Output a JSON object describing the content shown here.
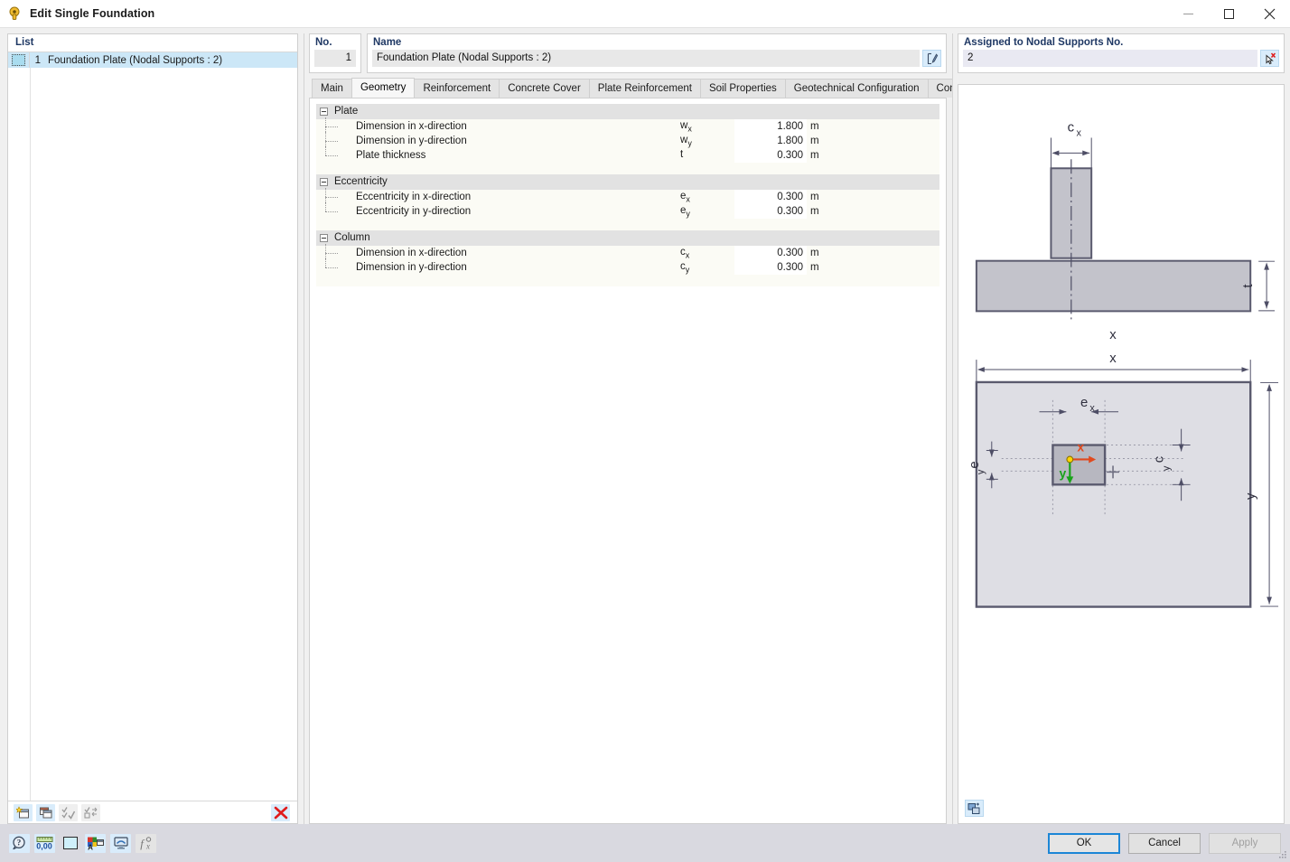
{
  "window": {
    "title": "Edit Single Foundation",
    "icon": "foundation-icon",
    "controls": {
      "minimize": "minimize-icon",
      "maximize": "maximize-icon",
      "close": "close-icon"
    }
  },
  "left_panel": {
    "header": "List",
    "rows": [
      {
        "num": "1",
        "label": "Foundation Plate (Nodal Supports : 2)",
        "selected": true
      }
    ],
    "toolbar": [
      {
        "name": "new-item-button",
        "enabled": true
      },
      {
        "name": "copy-item-button",
        "enabled": true
      },
      {
        "name": "select-all-button",
        "enabled": false
      },
      {
        "name": "invert-selection-button",
        "enabled": false
      },
      {
        "name": "delete-item-button",
        "enabled": true
      }
    ]
  },
  "fields": {
    "no_label": "No.",
    "no_value": "1",
    "name_label": "Name",
    "name_value": "Foundation Plate (Nodal Supports : 2)",
    "name_edit_icon": "edit-pencil-icon",
    "assigned_label": "Assigned to Nodal Supports No.",
    "assigned_value": "2",
    "assigned_pick_icon": "select-cursor-icon"
  },
  "tabs": [
    {
      "label": "Main",
      "active": false
    },
    {
      "label": "Geometry",
      "active": true
    },
    {
      "label": "Reinforcement",
      "active": false
    },
    {
      "label": "Concrete Cover",
      "active": false
    },
    {
      "label": "Plate Reinforcement",
      "active": false
    },
    {
      "label": "Soil Properties",
      "active": false
    },
    {
      "label": "Geotechnical Configuration",
      "active": false
    },
    {
      "label": "Concrete Configuration",
      "active": false
    }
  ],
  "property_groups": [
    {
      "title": "Plate",
      "expanded": true,
      "rows": [
        {
          "desc": "Dimension in x-direction",
          "sym": "w",
          "sub": "x",
          "value": "1.800",
          "unit": "m"
        },
        {
          "desc": "Dimension in y-direction",
          "sym": "w",
          "sub": "y",
          "value": "1.800",
          "unit": "m"
        },
        {
          "desc": "Plate thickness",
          "sym": "t",
          "sub": "",
          "value": "0.300",
          "unit": "m"
        }
      ]
    },
    {
      "title": "Eccentricity",
      "expanded": true,
      "rows": [
        {
          "desc": "Eccentricity in x-direction",
          "sym": "e",
          "sub": "x",
          "value": "0.300",
          "unit": "m"
        },
        {
          "desc": "Eccentricity in y-direction",
          "sym": "e",
          "sub": "y",
          "value": "0.300",
          "unit": "m"
        }
      ]
    },
    {
      "title": "Column",
      "expanded": true,
      "rows": [
        {
          "desc": "Dimension in x-direction",
          "sym": "c",
          "sub": "x",
          "value": "0.300",
          "unit": "m"
        },
        {
          "desc": "Dimension in y-direction",
          "sym": "c",
          "sub": "y",
          "value": "0.300",
          "unit": "m"
        }
      ]
    }
  ],
  "drawing": {
    "elevation_labels": {
      "column_width": "c",
      "column_width_sub": "x",
      "thickness": "t",
      "plate_width": "x"
    },
    "plan_labels": {
      "width": "x",
      "height": "y",
      "ecc_x": "e",
      "ecc_x_sub": "x",
      "ecc_y": "e",
      "ecc_y_sub": "y",
      "col_y": "c",
      "col_y_sub": "y",
      "axis_x": "x",
      "axis_y": "y"
    },
    "toolbutton_icon": "render-mode-icon",
    "colors": {
      "fill_plate": "#dedee4",
      "fill_column": "#b7b7c0",
      "stroke": "#5a5a6e",
      "axis_x": "#e04a1e",
      "axis_y": "#19a319",
      "origin": "#ffd400"
    }
  },
  "bottom_bar": {
    "left_buttons": [
      {
        "name": "help-button",
        "enabled": true
      },
      {
        "name": "number-format-button",
        "enabled": true
      },
      {
        "name": "color-swatch-button",
        "enabled": true
      },
      {
        "name": "display-properties-button",
        "enabled": true
      },
      {
        "name": "view-mode-button",
        "enabled": true
      },
      {
        "name": "function-button",
        "enabled": false
      }
    ],
    "ok": "OK",
    "cancel": "Cancel",
    "apply": "Apply"
  }
}
